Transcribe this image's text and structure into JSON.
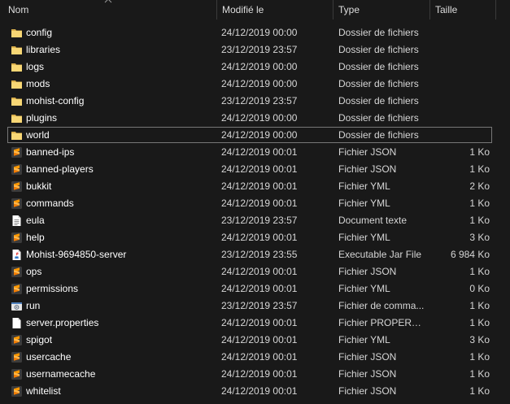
{
  "header": {
    "name": "Nom",
    "date": "Modifié le",
    "type": "Type",
    "size": "Taille"
  },
  "files": [
    {
      "name": "config",
      "date": "24/12/2019 00:00",
      "type": "Dossier de fichiers",
      "size": "",
      "icon": "folder-icon"
    },
    {
      "name": "libraries",
      "date": "23/12/2019 23:57",
      "type": "Dossier de fichiers",
      "size": "",
      "icon": "folder-icon"
    },
    {
      "name": "logs",
      "date": "24/12/2019 00:00",
      "type": "Dossier de fichiers",
      "size": "",
      "icon": "folder-icon"
    },
    {
      "name": "mods",
      "date": "24/12/2019 00:00",
      "type": "Dossier de fichiers",
      "size": "",
      "icon": "folder-icon"
    },
    {
      "name": "mohist-config",
      "date": "23/12/2019 23:57",
      "type": "Dossier de fichiers",
      "size": "",
      "icon": "folder-icon"
    },
    {
      "name": "plugins",
      "date": "24/12/2019 00:00",
      "type": "Dossier de fichiers",
      "size": "",
      "icon": "folder-icon"
    },
    {
      "name": "world",
      "date": "24/12/2019 00:00",
      "type": "Dossier de fichiers",
      "size": "",
      "icon": "folder-icon",
      "selected": true
    },
    {
      "name": "banned-ips",
      "date": "24/12/2019 00:01",
      "type": "Fichier JSON",
      "size": "1 Ko",
      "icon": "sublime-file-icon"
    },
    {
      "name": "banned-players",
      "date": "24/12/2019 00:01",
      "type": "Fichier JSON",
      "size": "1 Ko",
      "icon": "sublime-file-icon"
    },
    {
      "name": "bukkit",
      "date": "24/12/2019 00:01",
      "type": "Fichier YML",
      "size": "2 Ko",
      "icon": "sublime-file-icon"
    },
    {
      "name": "commands",
      "date": "24/12/2019 00:01",
      "type": "Fichier YML",
      "size": "1 Ko",
      "icon": "sublime-file-icon"
    },
    {
      "name": "eula",
      "date": "23/12/2019 23:57",
      "type": "Document texte",
      "size": "1 Ko",
      "icon": "text-document-icon"
    },
    {
      "name": "help",
      "date": "24/12/2019 00:01",
      "type": "Fichier YML",
      "size": "3 Ko",
      "icon": "sublime-file-icon"
    },
    {
      "name": "Mohist-9694850-server",
      "date": "23/12/2019 23:55",
      "type": "Executable Jar File",
      "size": "6 984 Ko",
      "icon": "java-jar-icon"
    },
    {
      "name": "ops",
      "date": "24/12/2019 00:01",
      "type": "Fichier JSON",
      "size": "1 Ko",
      "icon": "sublime-file-icon"
    },
    {
      "name": "permissions",
      "date": "24/12/2019 00:01",
      "type": "Fichier YML",
      "size": "0 Ko",
      "icon": "sublime-file-icon"
    },
    {
      "name": "run",
      "date": "23/12/2019 23:57",
      "type": "Fichier de comma...",
      "size": "1 Ko",
      "icon": "batch-file-icon"
    },
    {
      "name": "server.properties",
      "date": "24/12/2019 00:01",
      "type": "Fichier PROPERTIES",
      "size": "1 Ko",
      "icon": "blank-file-icon"
    },
    {
      "name": "spigot",
      "date": "24/12/2019 00:01",
      "type": "Fichier YML",
      "size": "3 Ko",
      "icon": "sublime-file-icon"
    },
    {
      "name": "usercache",
      "date": "24/12/2019 00:01",
      "type": "Fichier JSON",
      "size": "1 Ko",
      "icon": "sublime-file-icon"
    },
    {
      "name": "usernamecache",
      "date": "24/12/2019 00:01",
      "type": "Fichier JSON",
      "size": "1 Ko",
      "icon": "sublime-file-icon"
    },
    {
      "name": "whitelist",
      "date": "24/12/2019 00:01",
      "type": "Fichier JSON",
      "size": "1 Ko",
      "icon": "sublime-file-icon"
    }
  ],
  "colors": {
    "background": "#191919",
    "folder": "#f8d775",
    "sublime": "#ff9800",
    "selection_border": "#777777"
  }
}
